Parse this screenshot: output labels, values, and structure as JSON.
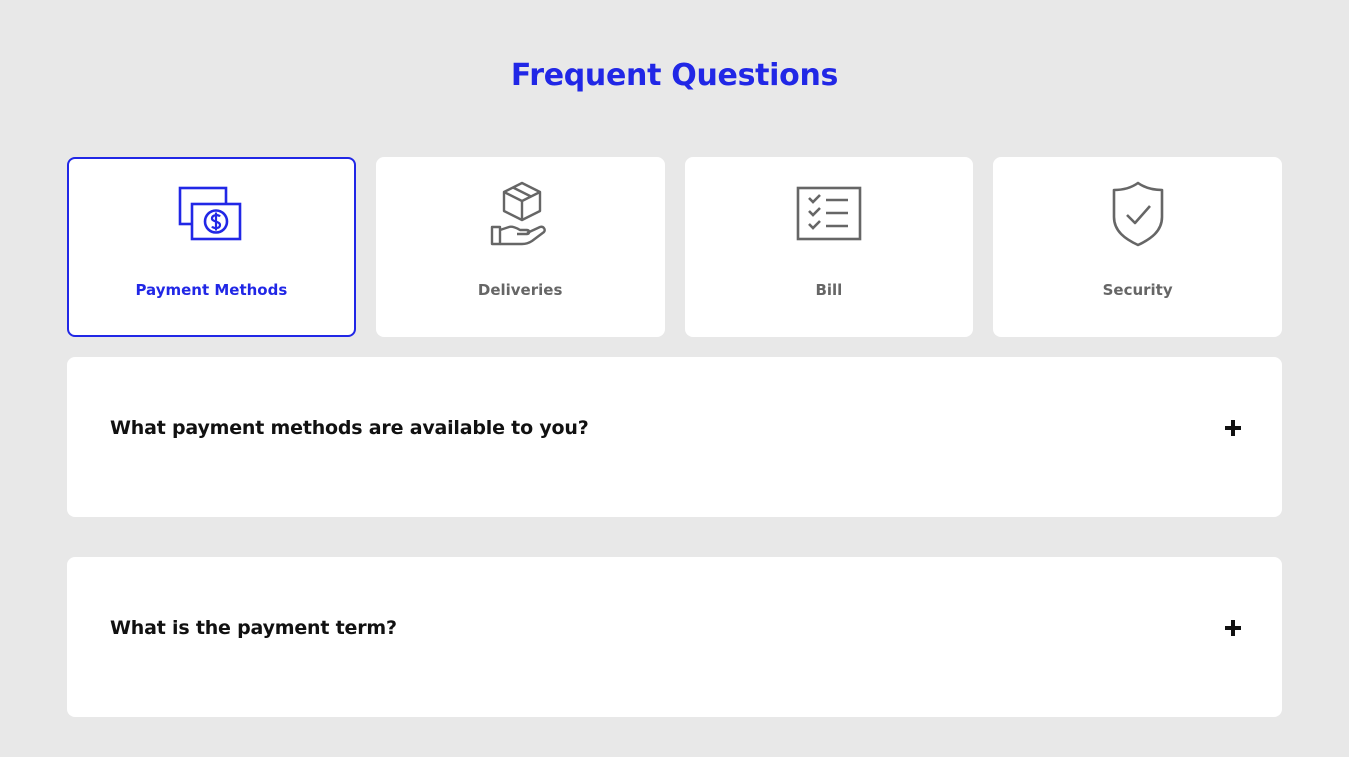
{
  "header": {
    "title": "Frequent Questions"
  },
  "categories": [
    {
      "label": "Payment Methods",
      "icon": "money-icon",
      "active": true
    },
    {
      "label": "Deliveries",
      "icon": "package-hand-icon",
      "active": false
    },
    {
      "label": "Bill",
      "icon": "checklist-icon",
      "active": false
    },
    {
      "label": "Security",
      "icon": "shield-check-icon",
      "active": false
    }
  ],
  "faqs": [
    {
      "question": "What payment methods are available to you?",
      "toggle_icon": "plus-icon"
    },
    {
      "question": "What is the payment term?",
      "toggle_icon": "plus-icon"
    }
  ],
  "colors": {
    "accent": "#2127e6",
    "background": "#e8e8e8",
    "card": "#ffffff",
    "inactive_text": "#666666",
    "question_text": "#111111"
  }
}
